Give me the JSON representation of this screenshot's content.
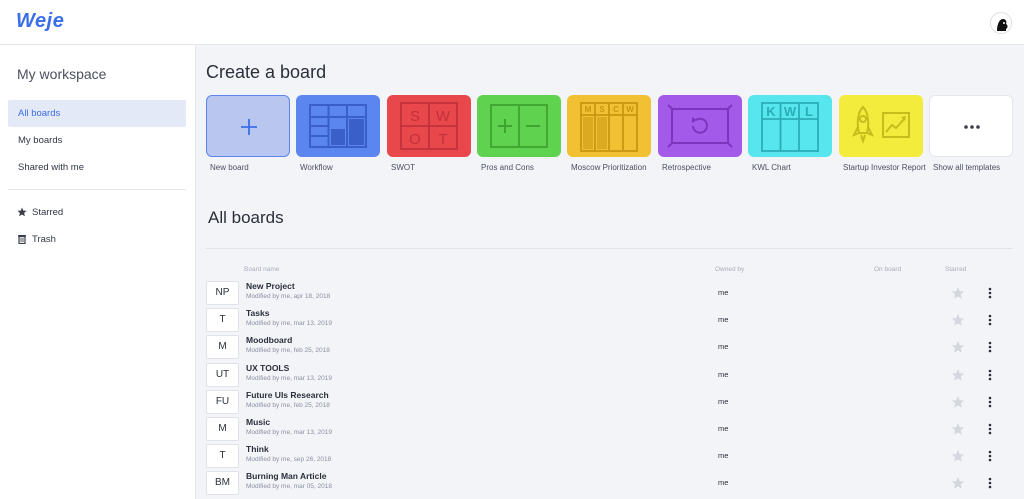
{
  "app": {
    "logo": "Weje"
  },
  "sidebar": {
    "workspace_title": "My workspace",
    "items": [
      {
        "label": "All boards",
        "active": true
      },
      {
        "label": "My boards",
        "active": false
      },
      {
        "label": "Shared with me",
        "active": false
      }
    ],
    "extras": [
      {
        "label": "Starred",
        "icon": "star-icon"
      },
      {
        "label": "Trash",
        "icon": "trash-icon"
      }
    ]
  },
  "create": {
    "title": "Create a board",
    "templates": [
      {
        "label": "New board",
        "icon": "plus-icon",
        "color": "#b9c7f0"
      },
      {
        "label": "Workflow",
        "icon": "workflow-icon",
        "color": "#5b86ef"
      },
      {
        "label": "SWOT",
        "icon": "swot-icon",
        "color": "#e8474c"
      },
      {
        "label": "Pros and Cons",
        "icon": "pros-cons-icon",
        "color": "#5fd24f"
      },
      {
        "label": "Moscow Prioritization",
        "icon": "moscow-icon",
        "color": "#f2c133"
      },
      {
        "label": "Retrospective",
        "icon": "retrospective-icon",
        "color": "#a45ae8"
      },
      {
        "label": "KWL Chart",
        "icon": "kwl-icon",
        "color": "#57e6ee"
      },
      {
        "label": "Startup Investor Report",
        "icon": "rocket-chart-icon",
        "color": "#f4ec3c"
      },
      {
        "label": "Show all templates",
        "icon": "more-horizontal-icon",
        "color": "#ffffff"
      }
    ],
    "swot_letters": [
      "S",
      "W",
      "O",
      "T"
    ],
    "moscow_letters": [
      "M",
      "S",
      "C",
      "W"
    ],
    "kwl_letters": [
      "K",
      "W",
      "L"
    ]
  },
  "boards": {
    "title": "All boards",
    "columns": {
      "name": "Board name",
      "owner": "Owned by",
      "on_board": "On board",
      "starred": "Starred"
    },
    "rows": [
      {
        "initials": "NP",
        "name": "New Project",
        "modified": "Modified by me, apr 18, 2018",
        "owner": "me"
      },
      {
        "initials": "T",
        "name": "Tasks",
        "modified": "Modified by me, mar 13, 2019",
        "owner": "me"
      },
      {
        "initials": "M",
        "name": "Moodboard",
        "modified": "Modified by me, feb 25, 2018",
        "owner": "me"
      },
      {
        "initials": "UT",
        "name": "UX TOOLS",
        "modified": "Modified by me, mar 13, 2019",
        "owner": "me"
      },
      {
        "initials": "FU",
        "name": "Future UIs Research",
        "modified": "Modified by me, feb 25, 2018",
        "owner": "me"
      },
      {
        "initials": "M",
        "name": "Music",
        "modified": "Modified by me, mar 13, 2019",
        "owner": "me"
      },
      {
        "initials": "T",
        "name": "Think",
        "modified": "Modified by me, sep 26, 2018",
        "owner": "me"
      },
      {
        "initials": "BM",
        "name": "Burning Man Article",
        "modified": "Modified by me, mar 05, 2018",
        "owner": "me"
      }
    ]
  }
}
